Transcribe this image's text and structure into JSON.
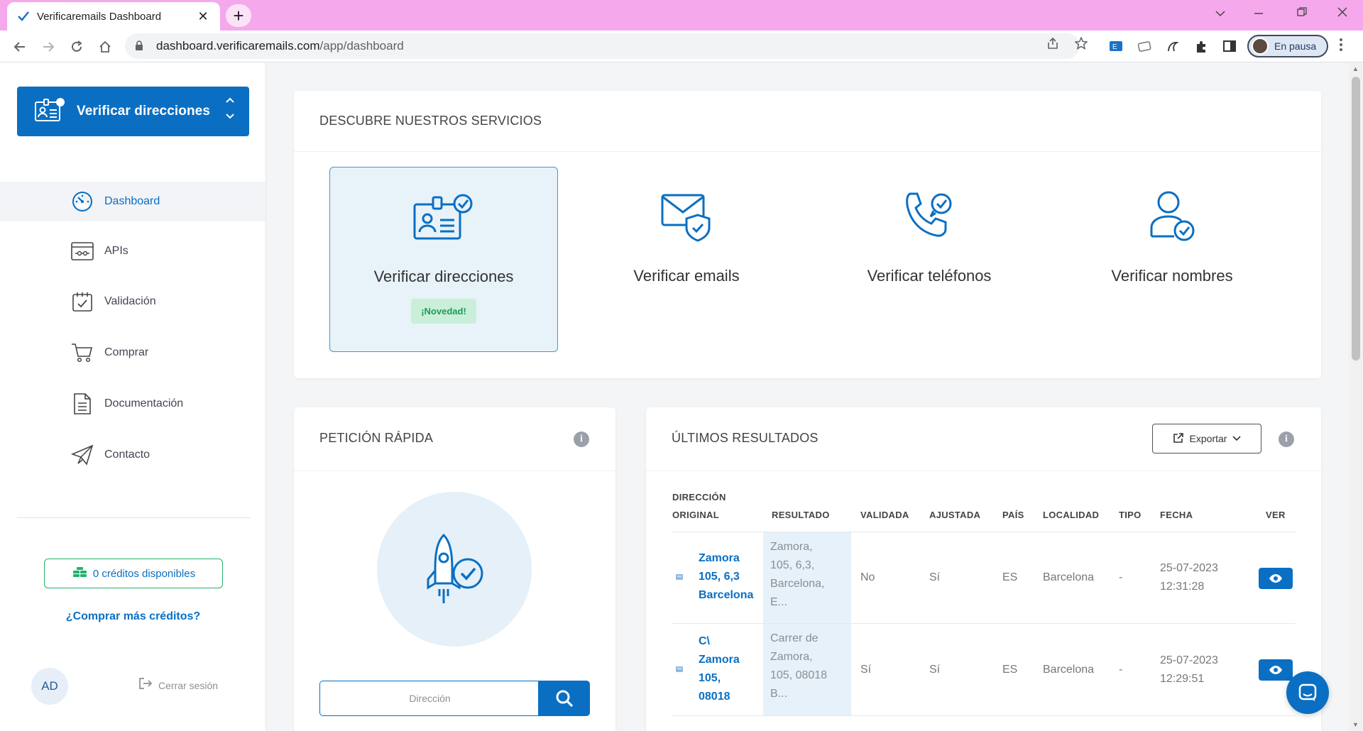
{
  "browser": {
    "tab_title": "Verificaremails Dashboard",
    "tab_close": "✕",
    "new_tab": "+",
    "url_host": "dashboard.verificaremails.com",
    "url_path": "/app/dashboard",
    "profile_status": "En pausa",
    "colors": {
      "tabbar": "#f5a8ec"
    }
  },
  "sidebar": {
    "service_selector": "Verificar direcciones",
    "nav": [
      {
        "label": "Dashboard",
        "icon": "speedometer-icon",
        "active": true
      },
      {
        "label": "APIs",
        "icon": "api-icon",
        "active": false
      },
      {
        "label": "Validación",
        "icon": "calendar-check-icon",
        "active": false
      },
      {
        "label": "Comprar",
        "icon": "cart-icon",
        "active": false
      },
      {
        "label": "Documentación",
        "icon": "document-icon",
        "active": false
      },
      {
        "label": "Contacto",
        "icon": "paper-plane-icon",
        "active": false
      }
    ],
    "credits": "0 créditos disponibles",
    "buy_more": "¿Comprar más créditos?",
    "avatar_initials": "AD",
    "logout": "Cerrar sesión"
  },
  "services": {
    "title": "DESCUBRE NUESTROS SERVICIOS",
    "items": [
      {
        "label": "Verificar direcciones",
        "icon": "address-card-icon",
        "badge": "¡Novedad!",
        "selected": true
      },
      {
        "label": "Verificar emails",
        "icon": "email-shield-icon",
        "selected": false
      },
      {
        "label": "Verificar teléfonos",
        "icon": "phone-check-icon",
        "selected": false
      },
      {
        "label": "Verificar nombres",
        "icon": "user-check-icon",
        "selected": false
      }
    ]
  },
  "quick_request": {
    "title": "PETICIÓN RÁPIDA",
    "input_placeholder": "Dirección"
  },
  "results": {
    "title": "ÚLTIMOS RESULTADOS",
    "export_label": "Exportar",
    "columns": [
      "DIRECCIÓN ORIGINAL",
      "RESULTADO",
      "VALIDADA",
      "AJUSTADA",
      "PAÍS",
      "LOCALIDAD",
      "TIPO",
      "FECHA",
      "VER"
    ],
    "column_lines": {
      "address_1": "DIRECCIÓN",
      "address_2": "ORIGINAL"
    },
    "rows": [
      {
        "address": [
          "Zamora",
          "105, 6,3",
          "Barcelona"
        ],
        "result": [
          "Zamora,",
          "105, 6,3,",
          "Barcelona,",
          "E..."
        ],
        "validada": "No",
        "ajustada": "Sí",
        "pais": "ES",
        "localidad": "Barcelona",
        "tipo": "-",
        "fecha": [
          "25-07-2023",
          "12:31:28"
        ]
      },
      {
        "address": [
          "C\\",
          "Zamora",
          "105,",
          "08018"
        ],
        "result": [
          "Carrer de",
          "Zamora,",
          "105, 08018",
          "B..."
        ],
        "validada": "Sí",
        "ajustada": "Sí",
        "pais": "ES",
        "localidad": "Barcelona",
        "tipo": "-",
        "fecha": [
          "25-07-2023",
          "12:29:51"
        ]
      }
    ]
  },
  "colors": {
    "primary": "#0a6fc2",
    "success": "#21b36c",
    "badge_bg": "#c9efd9"
  }
}
